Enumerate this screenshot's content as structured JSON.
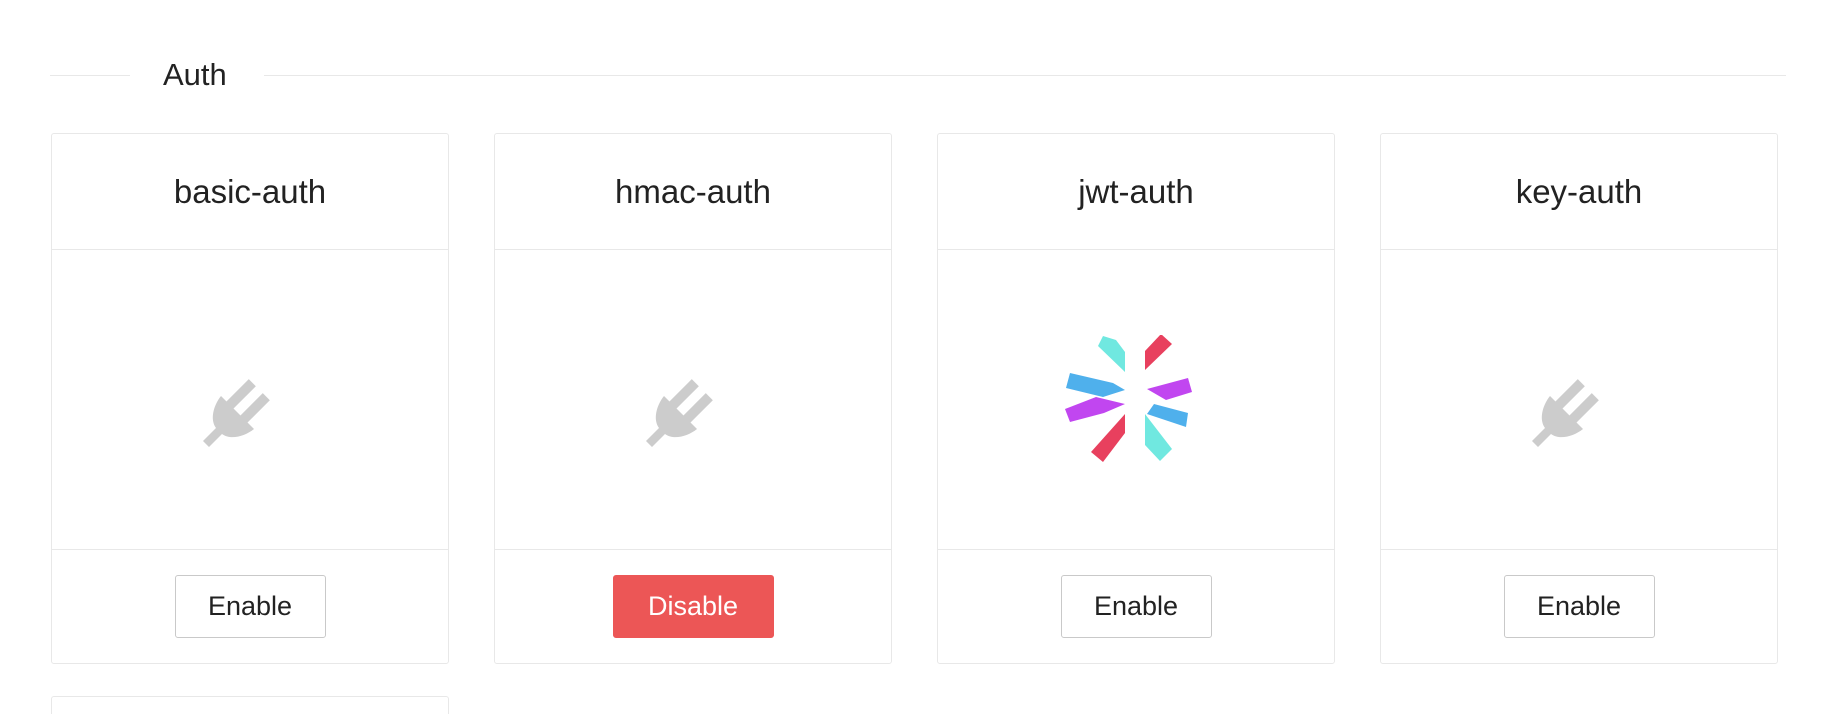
{
  "section": {
    "title": "Auth"
  },
  "plugins": [
    {
      "name": "basic-auth",
      "icon": "plug-icon",
      "button": "Enable"
    },
    {
      "name": "hmac-auth",
      "icon": "plug-icon",
      "button": "Disable"
    },
    {
      "name": "jwt-auth",
      "icon": "jwt-logo-icon",
      "button": "Enable"
    },
    {
      "name": "key-auth",
      "icon": "plug-icon",
      "button": "Enable"
    }
  ],
  "colors": {
    "disable_button": "#ec5656",
    "plug_icon": "#cccccc",
    "jwt_cyan": "#70e8e0",
    "jwt_red": "#e8405e",
    "jwt_purple": "#c146f0",
    "jwt_blue": "#4fb0ec"
  }
}
